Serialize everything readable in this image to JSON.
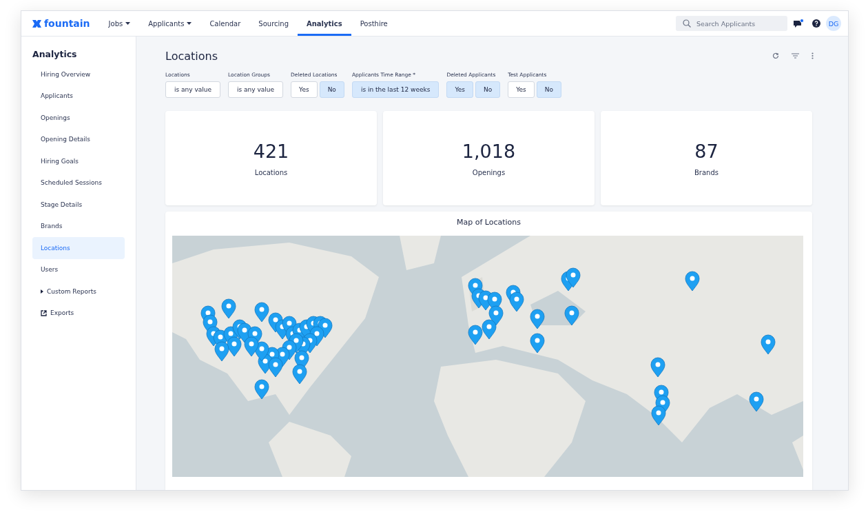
{
  "logo": {
    "text": "fountain"
  },
  "nav": [
    {
      "label": "Jobs",
      "dropdown": true,
      "selected": false
    },
    {
      "label": "Applicants",
      "dropdown": true,
      "selected": false
    },
    {
      "label": "Calendar",
      "dropdown": false,
      "selected": false
    },
    {
      "label": "Sourcing",
      "dropdown": false,
      "selected": false
    },
    {
      "label": "Analytics",
      "dropdown": false,
      "selected": true
    },
    {
      "label": "Posthire",
      "dropdown": false,
      "selected": false
    }
  ],
  "search": {
    "placeholder": "Search Applicants"
  },
  "notifications": {
    "unread": true
  },
  "avatar": {
    "initials": "DG"
  },
  "sidebar": {
    "title": "Analytics",
    "items": [
      {
        "label": "Hiring Overview",
        "kind": "link",
        "selected": false
      },
      {
        "label": "Applicants",
        "kind": "link",
        "selected": false
      },
      {
        "label": "Openings",
        "kind": "link",
        "selected": false
      },
      {
        "label": "Opening Details",
        "kind": "link",
        "selected": false
      },
      {
        "label": "Hiring Goals",
        "kind": "link",
        "selected": false
      },
      {
        "label": "Scheduled Sessions",
        "kind": "link",
        "selected": false
      },
      {
        "label": "Stage Details",
        "kind": "link",
        "selected": false
      },
      {
        "label": "Brands",
        "kind": "link",
        "selected": false
      },
      {
        "label": "Locations",
        "kind": "link",
        "selected": true
      },
      {
        "label": "Users",
        "kind": "link",
        "selected": false
      },
      {
        "label": "Custom Reports",
        "kind": "folder",
        "selected": false
      },
      {
        "label": "Exports",
        "kind": "external",
        "selected": false
      }
    ]
  },
  "page": {
    "title": "Locations"
  },
  "filters": [
    {
      "label": "Locations",
      "kind": "select",
      "options": [
        {
          "label": "is any value",
          "selected": false
        }
      ]
    },
    {
      "label": "Location Groups",
      "kind": "select",
      "options": [
        {
          "label": "is any value",
          "selected": false
        }
      ]
    },
    {
      "label": "Deleted Locations",
      "kind": "toggle",
      "options": [
        {
          "label": "Yes",
          "selected": false
        },
        {
          "label": "No",
          "selected": true
        }
      ]
    },
    {
      "label": "Applicants Time Range *",
      "kind": "select",
      "options": [
        {
          "label": "is in the last 12 weeks",
          "selected": true
        }
      ]
    },
    {
      "label": "Deleted Applicants",
      "kind": "toggle",
      "options": [
        {
          "label": "Yes",
          "selected": true
        },
        {
          "label": "No",
          "selected": true
        }
      ]
    },
    {
      "label": "Test Applicants",
      "kind": "toggle",
      "options": [
        {
          "label": "Yes",
          "selected": false
        },
        {
          "label": "No",
          "selected": true
        }
      ]
    }
  ],
  "stats": [
    {
      "value": "421",
      "label": "Locations"
    },
    {
      "value": "1,018",
      "label": "Openings"
    },
    {
      "value": "87",
      "label": "Brands"
    }
  ],
  "map": {
    "title": "Map of Locations",
    "kind": "picture"
  }
}
